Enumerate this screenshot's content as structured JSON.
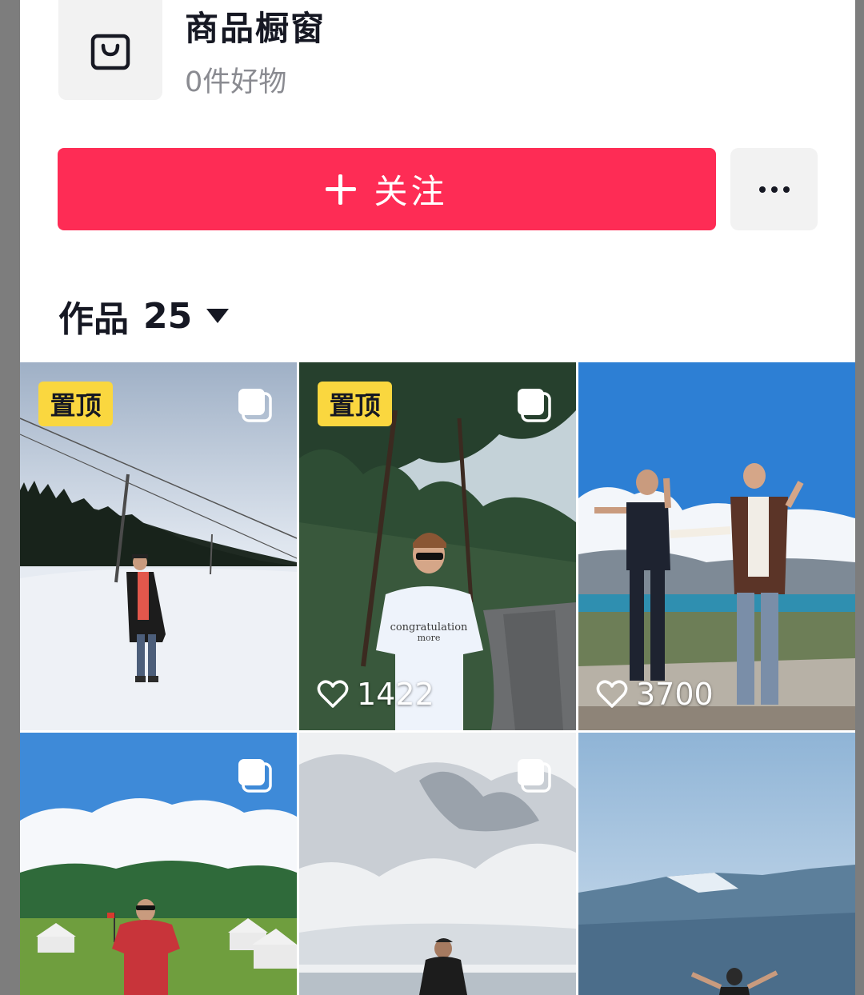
{
  "shop": {
    "title": "商品橱窗",
    "count_label": "0件好物",
    "icon": "shopping-bag-icon"
  },
  "actions": {
    "follow_label": "关注",
    "follow_icon": "plus-icon",
    "more_icon": "more-dots-icon"
  },
  "works": {
    "label": "作品",
    "count": "25",
    "dropdown_icon": "caret-down-icon"
  },
  "videos": [
    {
      "pinned": true,
      "pin_label": "置顶",
      "likes": "",
      "scene": "snow field with person in black coat"
    },
    {
      "pinned": true,
      "pin_label": "置顶",
      "likes": "1422",
      "scene": "pine forest road with person in white t-shirt"
    },
    {
      "pinned": false,
      "pin_label": "",
      "likes": "3700",
      "scene": "lake shore with two people dancing"
    },
    {
      "pinned": false,
      "pin_label": "",
      "likes": "",
      "scene": "grassland with yurts and person in red shirt"
    },
    {
      "pinned": false,
      "pin_label": "",
      "likes": "",
      "scene": "cloudy sky over lake with person"
    },
    {
      "pinned": false,
      "pin_label": "",
      "likes": "",
      "scene": "mountains with person raising arms"
    }
  ],
  "colors": {
    "accent": "#fe2c55",
    "pin_badge": "#fad73f",
    "text_primary": "#161823",
    "text_secondary": "#8a8b91"
  }
}
